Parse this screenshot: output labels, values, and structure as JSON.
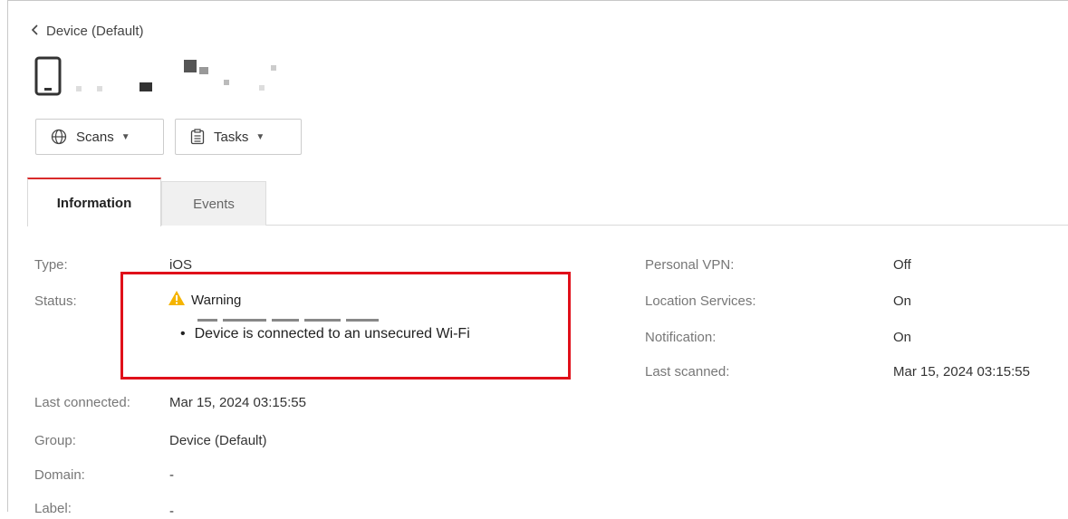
{
  "nav": {
    "back_label": "Device (Default)"
  },
  "actions": {
    "scans_label": "Scans",
    "tasks_label": "Tasks"
  },
  "tabs": [
    {
      "label": "Information",
      "active": true
    },
    {
      "label": "Events",
      "active": false
    }
  ],
  "info_left": {
    "type": {
      "label": "Type:",
      "value": "iOS"
    },
    "status": {
      "label": "Status:",
      "value": "Warning",
      "detail": "Device is connected to an unsecured Wi-Fi"
    },
    "last_connected": {
      "label": "Last connected:",
      "value": "Mar 15, 2024 03:15:55"
    },
    "group": {
      "label": "Group:",
      "value": "Device (Default)"
    },
    "domain": {
      "label": "Domain:",
      "value": "-"
    },
    "label": {
      "label": "Label:",
      "value": "-"
    }
  },
  "info_right": {
    "personal_vpn": {
      "label": "Personal VPN:",
      "value": "Off"
    },
    "location_services": {
      "label": "Location Services:",
      "value": "On"
    },
    "notification": {
      "label": "Notification:",
      "value": "On"
    },
    "last_scanned": {
      "label": "Last scanned:",
      "value": "Mar 15, 2024 03:15:55"
    }
  },
  "colors": {
    "accent": "#d92b2b",
    "highlight": "#e0101a",
    "warning": "#f5b400"
  },
  "icons": {
    "back": "chevron-left-icon",
    "device": "smartphone-icon",
    "scans": "globe-icon",
    "tasks": "clipboard-icon",
    "warning": "warning-triangle-icon"
  }
}
